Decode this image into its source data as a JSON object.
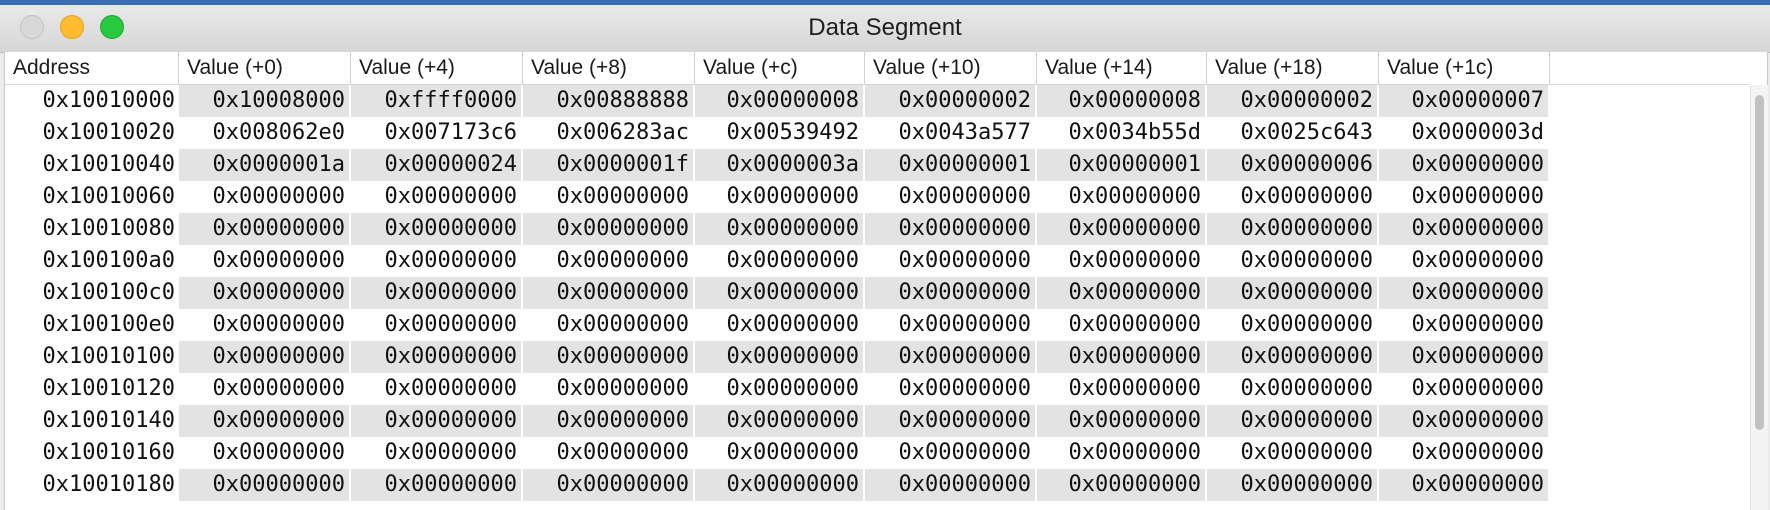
{
  "window": {
    "title": "Data Segment"
  },
  "table": {
    "columns": [
      "Address",
      "Value (+0)",
      "Value (+4)",
      "Value (+8)",
      "Value (+c)",
      "Value (+10)",
      "Value (+14)",
      "Value (+18)",
      "Value (+1c)"
    ],
    "rows": [
      [
        "0x10010000",
        "0x10008000",
        "0xffff0000",
        "0x00888888",
        "0x00000008",
        "0x00000002",
        "0x00000008",
        "0x00000002",
        "0x00000007"
      ],
      [
        "0x10010020",
        "0x008062e0",
        "0x007173c6",
        "0x006283ac",
        "0x00539492",
        "0x0043a577",
        "0x0034b55d",
        "0x0025c643",
        "0x0000003d"
      ],
      [
        "0x10010040",
        "0x0000001a",
        "0x00000024",
        "0x0000001f",
        "0x0000003a",
        "0x00000001",
        "0x00000001",
        "0x00000006",
        "0x00000000"
      ],
      [
        "0x10010060",
        "0x00000000",
        "0x00000000",
        "0x00000000",
        "0x00000000",
        "0x00000000",
        "0x00000000",
        "0x00000000",
        "0x00000000"
      ],
      [
        "0x10010080",
        "0x00000000",
        "0x00000000",
        "0x00000000",
        "0x00000000",
        "0x00000000",
        "0x00000000",
        "0x00000000",
        "0x00000000"
      ],
      [
        "0x100100a0",
        "0x00000000",
        "0x00000000",
        "0x00000000",
        "0x00000000",
        "0x00000000",
        "0x00000000",
        "0x00000000",
        "0x00000000"
      ],
      [
        "0x100100c0",
        "0x00000000",
        "0x00000000",
        "0x00000000",
        "0x00000000",
        "0x00000000",
        "0x00000000",
        "0x00000000",
        "0x00000000"
      ],
      [
        "0x100100e0",
        "0x00000000",
        "0x00000000",
        "0x00000000",
        "0x00000000",
        "0x00000000",
        "0x00000000",
        "0x00000000",
        "0x00000000"
      ],
      [
        "0x10010100",
        "0x00000000",
        "0x00000000",
        "0x00000000",
        "0x00000000",
        "0x00000000",
        "0x00000000",
        "0x00000000",
        "0x00000000"
      ],
      [
        "0x10010120",
        "0x00000000",
        "0x00000000",
        "0x00000000",
        "0x00000000",
        "0x00000000",
        "0x00000000",
        "0x00000000",
        "0x00000000"
      ],
      [
        "0x10010140",
        "0x00000000",
        "0x00000000",
        "0x00000000",
        "0x00000000",
        "0x00000000",
        "0x00000000",
        "0x00000000",
        "0x00000000"
      ],
      [
        "0x10010160",
        "0x00000000",
        "0x00000000",
        "0x00000000",
        "0x00000000",
        "0x00000000",
        "0x00000000",
        "0x00000000",
        "0x00000000"
      ],
      [
        "0x10010180",
        "0x00000000",
        "0x00000000",
        "0x00000000",
        "0x00000000",
        "0x00000000",
        "0x00000000",
        "0x00000000",
        "0x00000000"
      ]
    ]
  }
}
